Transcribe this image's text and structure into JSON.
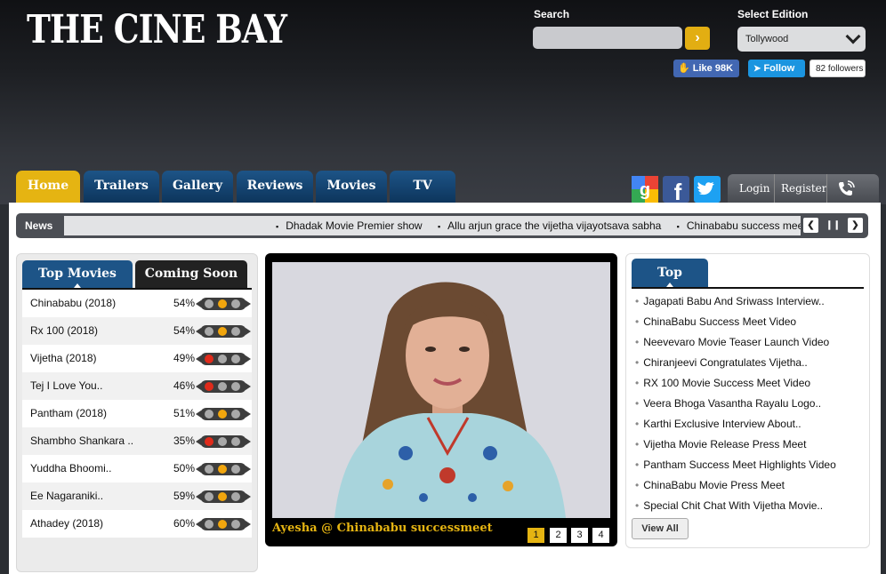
{
  "site": {
    "logo_text": "The Cine Bay"
  },
  "search": {
    "label": "Search",
    "placeholder": "",
    "go_label": "›"
  },
  "edition": {
    "label": "Select Edition",
    "value": "Tollywood"
  },
  "social": {
    "like_label": "Like 98K",
    "follow_label": "Follow",
    "followers_label": "82 followers"
  },
  "nav": {
    "tabs": [
      "Home",
      "Trailers",
      "Gallery",
      "Reviews",
      "Movies",
      "TV"
    ],
    "active": "Home"
  },
  "account": {
    "login_label": "Login",
    "register_label": "Register"
  },
  "news": {
    "label": "News",
    "items": [
      "Dhadak Movie Premier show",
      "Allu arjun grace the vijetha vijayotsava sabha",
      "Chinababu success meet"
    ]
  },
  "movies_panel": {
    "tabs": [
      "Top Movies",
      "Coming Soon"
    ],
    "rows": [
      {
        "title": "Chinababu (2018)",
        "rating": "54%",
        "level": "yellow"
      },
      {
        "title": "Rx 100 (2018)",
        "rating": "54%",
        "level": "yellow"
      },
      {
        "title": "Vijetha (2018)",
        "rating": "49%",
        "level": "red"
      },
      {
        "title": "Tej I Love You..",
        "rating": "46%",
        "level": "red"
      },
      {
        "title": "Pantham (2018)",
        "rating": "51%",
        "level": "yellow"
      },
      {
        "title": "Shambho Shankara ..",
        "rating": "35%",
        "level": "red"
      },
      {
        "title": "Yuddha Bhoomi..",
        "rating": "50%",
        "level": "yellow"
      },
      {
        "title": "Ee Nagaraniki..",
        "rating": "59%",
        "level": "yellow"
      },
      {
        "title": "Athadey (2018)",
        "rating": "60%",
        "level": "yellow"
      }
    ]
  },
  "featured": {
    "caption": "Ayesha @ Chinababu successmeet",
    "pages": [
      "1",
      "2",
      "3",
      "4"
    ],
    "active_page": "1"
  },
  "stories": {
    "title": "Top Stories",
    "items": [
      "Jagapati Babu And Sriwass Interview..",
      "ChinaBabu Success Meet Video",
      "Neevevaro Movie Teaser Launch Video",
      "Chiranjeevi Congratulates Vijetha..",
      "RX 100 Movie Success Meet Video",
      "Veera Bhoga Vasantha Rayalu Logo..",
      "Karthi Exclusive Interview About..",
      "Vijetha Movie Release Press Meet",
      "Pantham Success Meet Highlights Video",
      "ChinaBabu Movie Press Meet",
      "Special Chit Chat With Vijetha Movie.."
    ],
    "view_all_label": "View All"
  },
  "colors": {
    "accent": "#e5b412",
    "nav_blue": "#1d5487",
    "header_dark": "#1d1f23"
  }
}
